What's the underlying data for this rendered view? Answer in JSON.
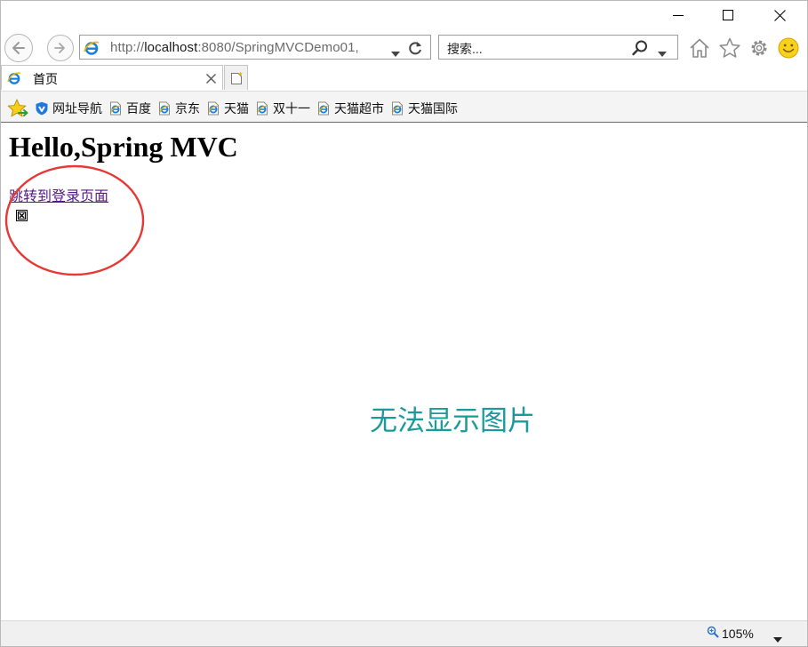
{
  "window": {
    "controls": {
      "minimize": "minimize",
      "maximize": "maximize",
      "close": "close"
    }
  },
  "navbar": {
    "address": {
      "prefix": "http://",
      "host": "localhost",
      "rest": ":8080/SpringMVCDemo01,"
    },
    "search": {
      "placeholder": "搜索..."
    },
    "icons": [
      "back-arrow-icon",
      "forward-arrow-icon",
      "ie-logo-icon",
      "refresh-icon",
      "search-icon",
      "home-icon",
      "star-icon",
      "gear-icon",
      "smiley-icon"
    ]
  },
  "tabs": [
    {
      "label": "首页",
      "active": true
    }
  ],
  "favorites": [
    {
      "label": "网址导航",
      "icon": "shield-icon"
    },
    {
      "label": "百度",
      "icon": "ie-page-icon"
    },
    {
      "label": "京东",
      "icon": "ie-page-icon"
    },
    {
      "label": "天猫",
      "icon": "ie-page-icon"
    },
    {
      "label": "双十一",
      "icon": "ie-page-icon"
    },
    {
      "label": "天猫超市",
      "icon": "ie-page-icon"
    },
    {
      "label": "天猫国际",
      "icon": "ie-page-icon"
    }
  ],
  "page": {
    "heading": "Hello,Spring MVC",
    "link": "跳转到登录页面",
    "no_image_text": "无法显示图片",
    "broken_image_icon": "broken-image-icon",
    "annotation_color": "#e53935",
    "no_image_color": "#1a9a9a",
    "link_color": "#551a8b"
  },
  "status": {
    "zoom": "105%"
  }
}
